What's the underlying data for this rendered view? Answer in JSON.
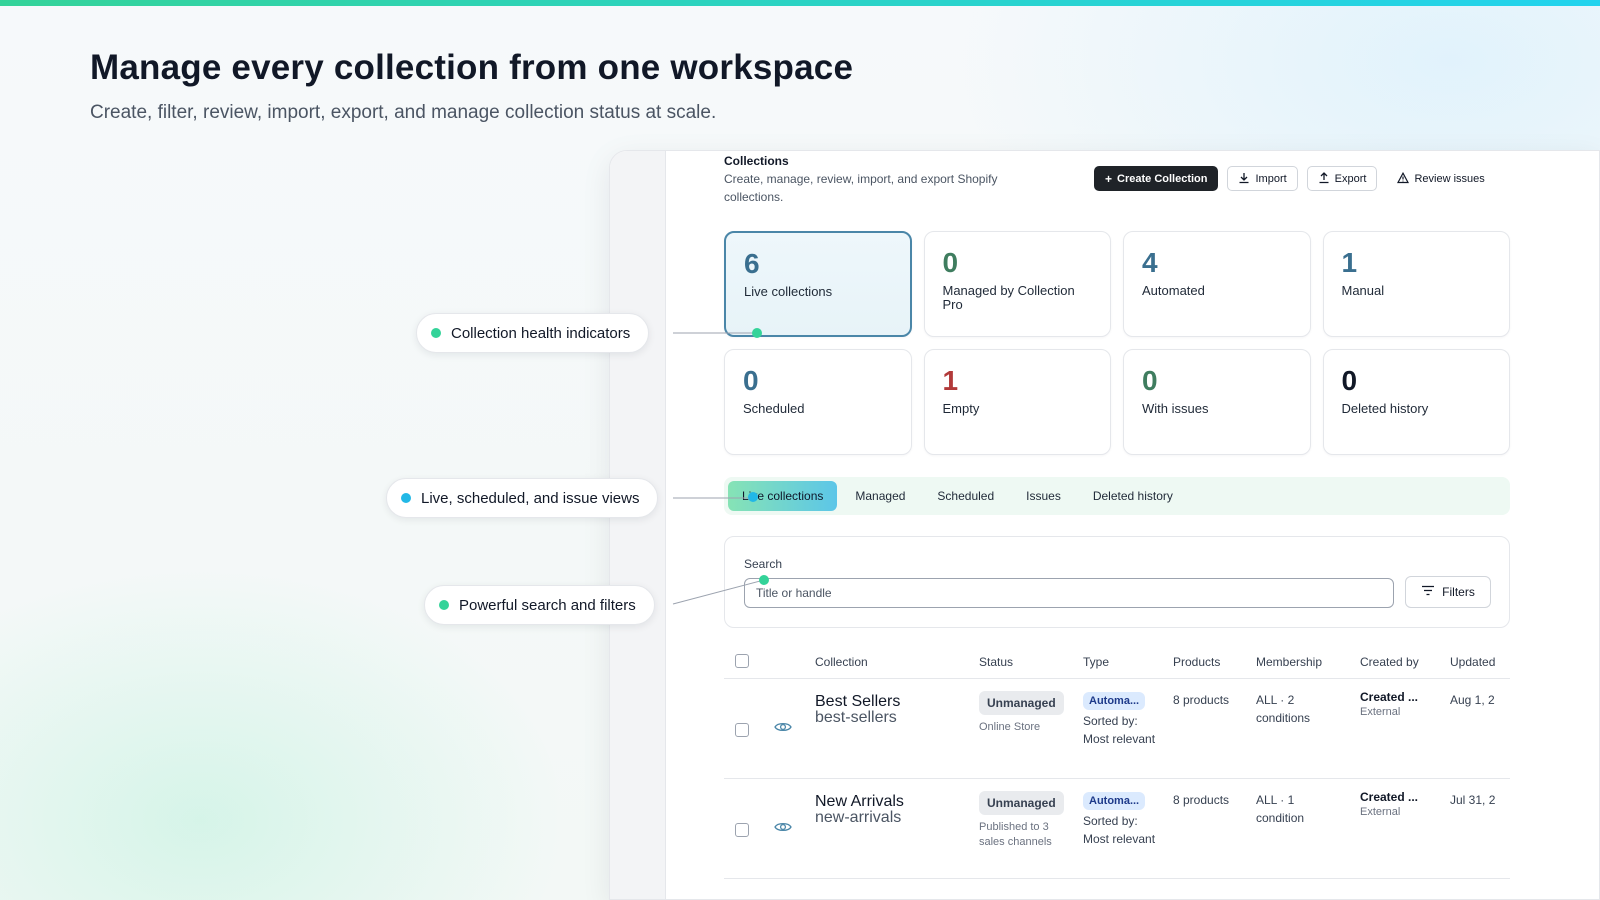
{
  "hero": {
    "title": "Manage every collection from one workspace",
    "subtitle": "Create, filter, review, import, export, and manage collection status at scale."
  },
  "callouts": [
    {
      "label": "Collection health indicators",
      "dot_color": "#34d399"
    },
    {
      "label": "Live, scheduled, and issue views",
      "dot_color": "#22b8e6"
    },
    {
      "label": "Powerful search and filters",
      "dot_color": "#34d399"
    }
  ],
  "app": {
    "title": "Collections",
    "description": "Create, manage, review, import, and export Shopify collections.",
    "actions": {
      "create": "Create Collection",
      "import": "Import",
      "export": "Export",
      "review": "Review issues"
    },
    "stats": [
      {
        "value": "6",
        "label": "Live collections",
        "color": "#3a6f8f"
      },
      {
        "value": "0",
        "label": "Managed by Collection Pro",
        "color": "#3f7d5f"
      },
      {
        "value": "4",
        "label": "Automated",
        "color": "#3a6f8f"
      },
      {
        "value": "1",
        "label": "Manual",
        "color": "#3a6f8f"
      },
      {
        "value": "0",
        "label": "Scheduled",
        "color": "#3a6f8f"
      },
      {
        "value": "1",
        "label": "Empty",
        "color": "#b23a3a"
      },
      {
        "value": "0",
        "label": "With issues",
        "color": "#3f7d5f"
      },
      {
        "value": "0",
        "label": "Deleted history",
        "color": "#111827"
      }
    ],
    "tabs": [
      "Live collections",
      "Managed",
      "Scheduled",
      "Issues",
      "Deleted history"
    ],
    "search": {
      "label": "Search",
      "placeholder": "Title or handle",
      "filters_label": "Filters"
    },
    "table": {
      "columns": {
        "collection": "Collection",
        "status": "Status",
        "type": "Type",
        "products": "Products",
        "membership": "Membership",
        "created_by": "Created by",
        "updated": "Updated"
      },
      "rows": [
        {
          "title": "Best Sellers",
          "handle": "best-sellers",
          "status": "Unmanaged",
          "status_sub": "Online Store",
          "type": "Automa...",
          "type_sub": "Sorted by: Most relevant",
          "products": "8 products",
          "membership": "ALL · 2 conditions",
          "created_by": "Created ...",
          "created_sub": "External",
          "updated": "Aug 1, 2"
        },
        {
          "title": "New Arrivals",
          "handle": "new-arrivals",
          "status": "Unmanaged",
          "status_sub": "Published to 3 sales channels",
          "type": "Automa...",
          "type_sub": "Sorted by: Most relevant",
          "products": "8 products",
          "membership": "ALL · 1 condition",
          "created_by": "Created ...",
          "created_sub": "External",
          "updated": "Jul 31, 2"
        }
      ]
    }
  }
}
